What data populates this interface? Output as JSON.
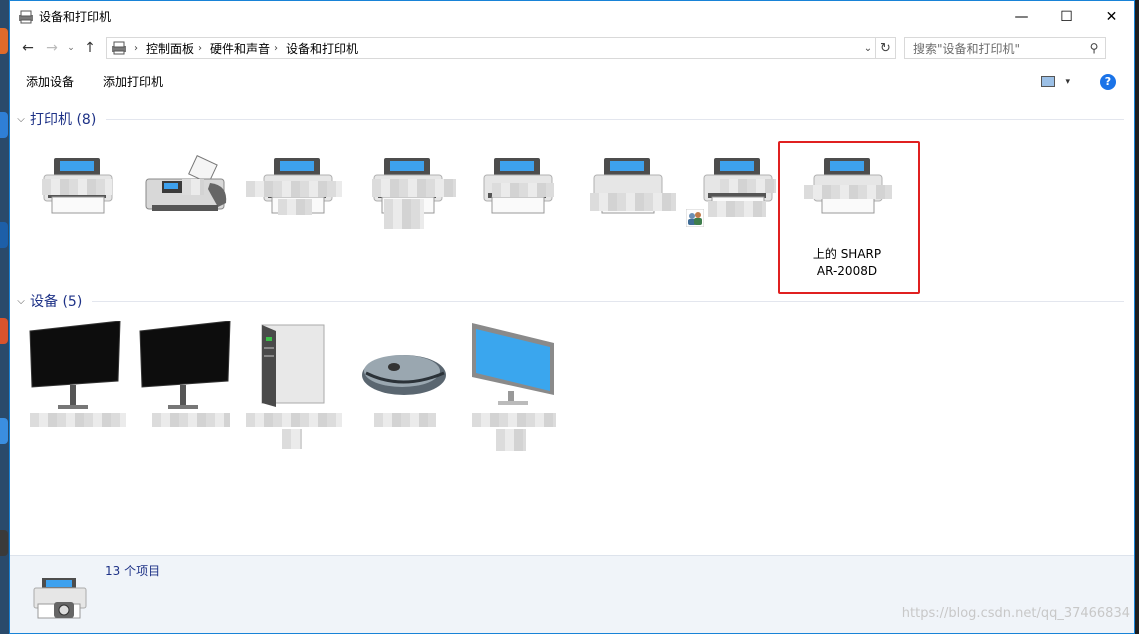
{
  "window": {
    "title": "设备和打印机"
  },
  "controls": {
    "minimize": "—",
    "maximize": "☐",
    "close": "✕"
  },
  "nav": {
    "back": "←",
    "forward": "→",
    "history": "⌄",
    "up": "↑"
  },
  "breadcrumb": {
    "items": [
      "控制面板",
      "硬件和声音",
      "设备和打印机"
    ],
    "separator": "›",
    "dropdown": "⌄",
    "refresh": "↻"
  },
  "search": {
    "placeholder": "搜索\"设备和打印机\"",
    "icon": "search-icon"
  },
  "toolbar": {
    "add_device": "添加设备",
    "add_printer": "添加打印机",
    "view_dropdown": "▾",
    "help": "?"
  },
  "groups": {
    "printers": {
      "title": "打印机 (8)",
      "chevron": "⌵"
    },
    "devices": {
      "title": "设备 (5)",
      "chevron": "⌵"
    }
  },
  "printers": [
    {
      "kind": "printer",
      "label": ""
    },
    {
      "kind": "fax",
      "label": ""
    },
    {
      "kind": "printer",
      "label": ""
    },
    {
      "kind": "printer",
      "label": ""
    },
    {
      "kind": "printer",
      "label": ""
    },
    {
      "kind": "printer",
      "label": ""
    },
    {
      "kind": "printer-shared",
      "label": ""
    },
    {
      "kind": "printer",
      "label": "上的 SHARP\nAR-2008D",
      "selected": true
    }
  ],
  "devices": [
    {
      "kind": "monitor-black",
      "label": ""
    },
    {
      "kind": "monitor-black",
      "label": ""
    },
    {
      "kind": "computer-tower",
      "label": ""
    },
    {
      "kind": "mouse",
      "label": ""
    },
    {
      "kind": "monitor-blue",
      "label": ""
    }
  ],
  "status": {
    "count": "13 个项目"
  },
  "watermark": "https://blog.csdn.net/qq_37466834",
  "colors": {
    "accent": "#1883d7",
    "group_title": "#1e3287",
    "selection": "#e02020",
    "status_bg": "#f0f4f9"
  }
}
